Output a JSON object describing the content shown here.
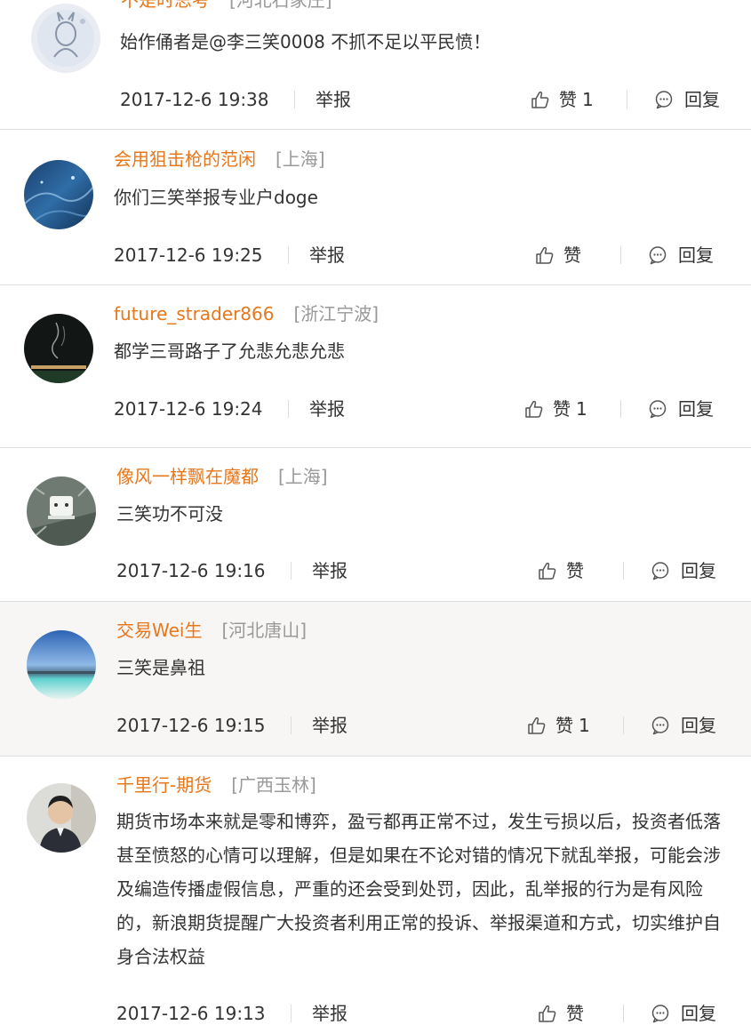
{
  "comments": [
    {
      "username": "不是时思考",
      "location": "[河北石家庄]",
      "text": "始作俑者是@李三笑0008 不抓不足以平民愤！",
      "time": "2017-12-6 19:38",
      "report": "举报",
      "like": "赞",
      "likes": "1",
      "reply": "回复"
    },
    {
      "username": "会用狙击枪的范闲",
      "location": "[上海]",
      "text": "你们三笑举报专业户doge",
      "time": "2017-12-6 19:25",
      "report": "举报",
      "like": "赞",
      "likes": "",
      "reply": "回复"
    },
    {
      "username": "future_strader866",
      "location": "[浙江宁波]",
      "text": "都学三哥路子了允悲允悲允悲",
      "time": "2017-12-6 19:24",
      "report": "举报",
      "like": "赞",
      "likes": "1",
      "reply": "回复"
    },
    {
      "username": "像风一样飘在魔都",
      "location": "[上海]",
      "text": "三笑功不可没",
      "time": "2017-12-6 19:16",
      "report": "举报",
      "like": "赞",
      "likes": "",
      "reply": "回复"
    },
    {
      "username": "交易Wei生",
      "location": "[河北唐山]",
      "text": "三笑是鼻祖",
      "time": "2017-12-6 19:15",
      "report": "举报",
      "like": "赞",
      "likes": "1",
      "reply": "回复"
    },
    {
      "username": "千里行-期货",
      "location": "[广西玉林]",
      "text": "期货市场本来就是零和博弈，盈亏都再正常不过，发生亏损以后，投资者低落甚至愤怒的心情可以理解，但是如果在不论对错的情况下就乱举报，可能会涉及编造传播虚假信息，严重的还会受到处罚，因此，乱举报的行为是有风险的，新浪期货提醒广大投资者利用正常的投诉、举报渠道和方式，切实维护自身合法权益",
      "time": "2017-12-6 19:13",
      "report": "举报",
      "like": "赞",
      "likes": "",
      "reply": "回复"
    }
  ],
  "colors": {
    "username": "#e8771b",
    "location": "#999999",
    "text": "#333333",
    "highlight_row": "#f8f6f4",
    "divider": "#dedede"
  },
  "icons": {
    "like": "thumbs-up-icon",
    "reply": "speech-bubble-icon"
  }
}
